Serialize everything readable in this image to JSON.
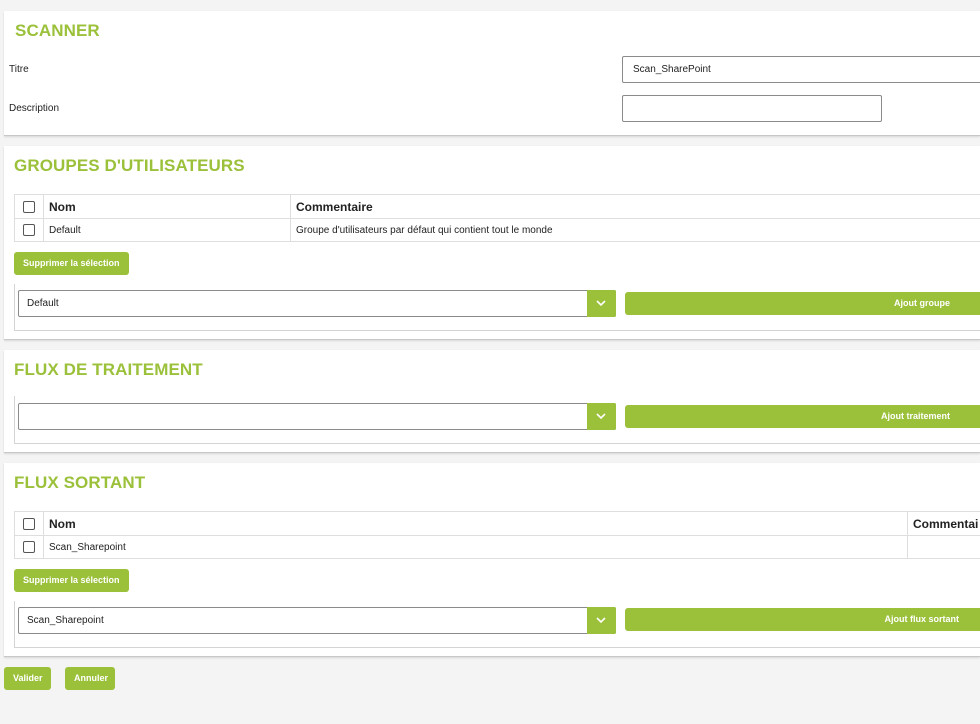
{
  "scanner": {
    "title": "SCANNER",
    "titre_label": "Titre",
    "titre_value": "Scan_SharePoint",
    "description_label": "Description",
    "description_value": ""
  },
  "groups": {
    "title": "GROUPES D'UTILISATEURS",
    "columns": [
      "Nom",
      "Commentaire"
    ],
    "rows": [
      {
        "nom": "Default",
        "commentaire": "Groupe d'utilisateurs par défaut qui contient tout le monde"
      }
    ],
    "delete_label": "Supprimer la sélection",
    "select_value": "Default",
    "add_label": "Ajout groupe"
  },
  "processing": {
    "title": "FLUX DE TRAITEMENT",
    "select_value": "",
    "add_label": "Ajout traitement"
  },
  "outgoing": {
    "title": "FLUX SORTANT",
    "columns": [
      "Nom",
      "Commentai"
    ],
    "rows": [
      {
        "nom": "Scan_Sharepoint",
        "commentaire": ""
      }
    ],
    "delete_label": "Supprimer la sélection",
    "select_value": "Scan_Sharepoint",
    "add_label": "Ajout flux sortant"
  },
  "actions": {
    "validate_label": "Valider",
    "cancel_label": "Annuler"
  },
  "colors": {
    "accent": "#9bc03a",
    "background": "#f4f4f4"
  }
}
